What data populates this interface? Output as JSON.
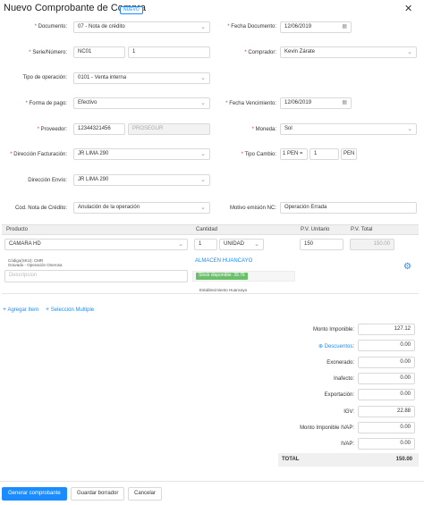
{
  "header": {
    "title": "Nuevo Comprobante de Compra",
    "badge": "NUEVO"
  },
  "form": {
    "documento": {
      "label": "Documento",
      "value": "07 - Nota de crédito"
    },
    "fecha_documento": {
      "label": "Fecha Documento",
      "value": "12/06/2019"
    },
    "serie_numero": {
      "label": "Serie/Número",
      "serie": "NC01",
      "numero": "1"
    },
    "comprador": {
      "label": "Comprador",
      "value": "Kevin Zárate"
    },
    "tipo_operacion": {
      "label": "Tipo de operación",
      "value": "0101 - Venta interna"
    },
    "forma_pago": {
      "label": "Forma de pago",
      "value": "Efectivo"
    },
    "fecha_vencimiento": {
      "label": "Fecha Vencimiento",
      "value": "12/06/2019"
    },
    "proveedor": {
      "label": "Proveedor",
      "ruc": "12344321456",
      "nombre": "PROSEGUR"
    },
    "moneda": {
      "label": "Moneda",
      "value": "Sol"
    },
    "direccion_facturacion": {
      "label": "Dirección Facturación",
      "value": "JR LIMA 290"
    },
    "tipo_cambio": {
      "label": "Tipo Cambio",
      "unit": "1 PEN =",
      "value": "1",
      "currency": "PEN"
    },
    "direccion_envio": {
      "label": "Dirección Envío",
      "value": "JR LIMA 290"
    },
    "cod_nota_credito": {
      "label": "Cod. Nota de Crédito",
      "value": "Anulación de la operación"
    },
    "motivo_emision": {
      "label": "Motivo emisión NC",
      "value": "Operación Errada"
    }
  },
  "table": {
    "headers": {
      "producto": "Producto",
      "cantidad": "Cantidad",
      "pv_unitario": "P.V. Unitario",
      "pv_total": "P.V. Total"
    },
    "row": {
      "producto": "CAMARA HD",
      "codigo": "Código(SKU): CMR",
      "tipo": "Gravado - Operación Onerosa",
      "descripcion_placeholder": "Descripcion",
      "cantidad": "1",
      "unidad": "UNIDAD",
      "almacen": "ALMACEN HUANCAYO",
      "stock": "Stock disponible: 39.76",
      "establecimiento": "Establecimiento Huancayo",
      "pv_unitario": "150",
      "pv_total": "150.00"
    }
  },
  "actions": {
    "agregar_item": "Agregar Item",
    "seleccion_multiple": "Selección Multiple"
  },
  "summary": {
    "monto_imponible": {
      "label": "Monto Imponible",
      "value": "127.12"
    },
    "descuentos": {
      "label": "Descuentos",
      "value": "0.00"
    },
    "exonerado": {
      "label": "Exonerado",
      "value": "0.00"
    },
    "inafecto": {
      "label": "Inafecto",
      "value": "0.00"
    },
    "exportacion": {
      "label": "Exportación",
      "value": "0.00"
    },
    "igv": {
      "label": "IGV",
      "value": "22.88"
    },
    "monto_imponible_ivap": {
      "label": "Monto Imponible IVAP",
      "value": "0.00"
    },
    "ivap": {
      "label": "IVAP",
      "value": "0.00"
    },
    "total": {
      "label": "TOTAL",
      "value": "150.00"
    }
  },
  "footer": {
    "generar": "Generar comprobante",
    "guardar": "Guardar borrador",
    "cancelar": "Cancelar"
  },
  "colors": {
    "accent": "#1a8cff",
    "required": "#e53935",
    "stock": "#6abf69"
  }
}
